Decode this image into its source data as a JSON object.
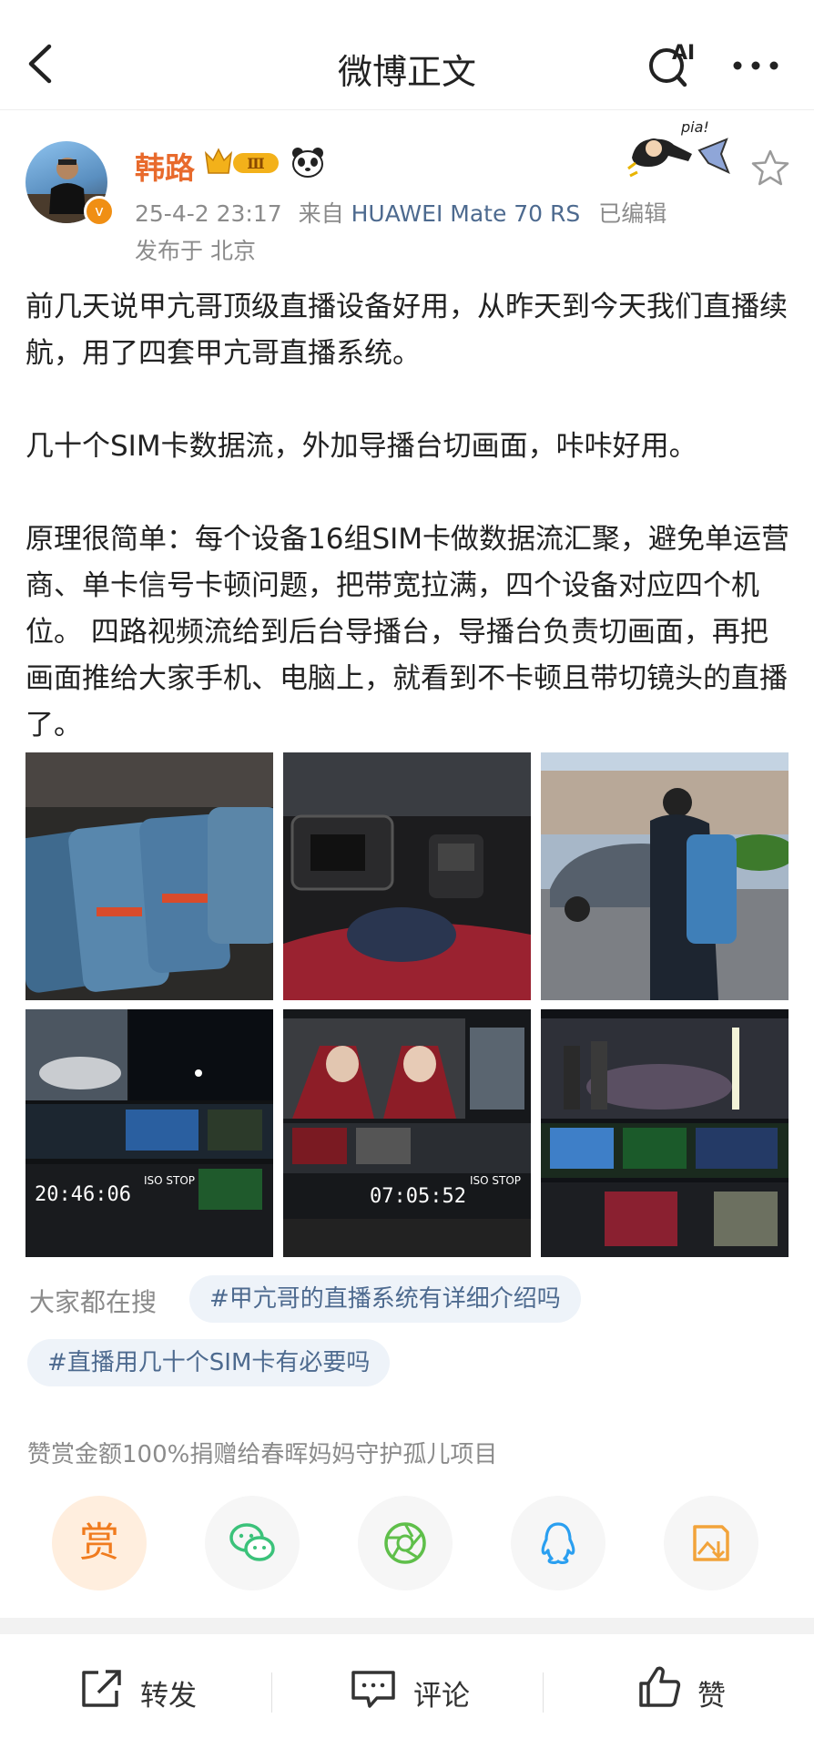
{
  "header": {
    "title": "微博正文",
    "ai_label": "AI",
    "more_label": "···"
  },
  "author": {
    "name": "韩路",
    "level_badge": "Ⅲ",
    "verify_mark": "v",
    "timestamp": "25-4-2 23:17",
    "source_prefix": "来自",
    "device": "HUAWEI Mate 70 RS",
    "edited": "已编辑",
    "location": "发布于 北京",
    "sticker_text": "pia!"
  },
  "post": {
    "paragraphs": [
      "前几天说甲亢哥顶级直播设备好用，从昨天到今天我们直播续航，用了四套甲亢哥直播系统。",
      "几十个SIM卡数据流，外加导播台切画面，咔咔好用。",
      "原理很简单：每个设备16组SIM卡做数据流汇聚，避免单运营商、单卡信号卡顿问题，把带宽拉满，四个设备对应四个机位。 四路视频流给到后台导播台，导播台负责切画面，再把画面推给大家手机、电脑上，就看到不卡顿且带切镜头的直播了。"
    ],
    "image_texts": {
      "clock1": "20:46:06",
      "clock2": "07:05:52",
      "iso1": "ISO STOP",
      "iso2": "ISO STOP"
    }
  },
  "search": {
    "label": "大家都在搜",
    "tags": [
      "#甲亢哥的直播系统有详细介绍吗",
      "#直播用几十个SIM卡有必要吗"
    ]
  },
  "donation": {
    "text": "赞赏金额100%捐赠给春晖妈妈守护孤儿项目",
    "reward_label": "赏"
  },
  "bottom_bar": {
    "repost": "转发",
    "comment": "评论",
    "like": "赞"
  },
  "colors": {
    "accent_orange": "#e86a2c",
    "link_blue": "#4d6a8f",
    "wechat_green": "#3bc27a",
    "moments_green": "#5fbf4a",
    "qq_blue": "#2a9ff0",
    "save_orange": "#f2a33a"
  }
}
